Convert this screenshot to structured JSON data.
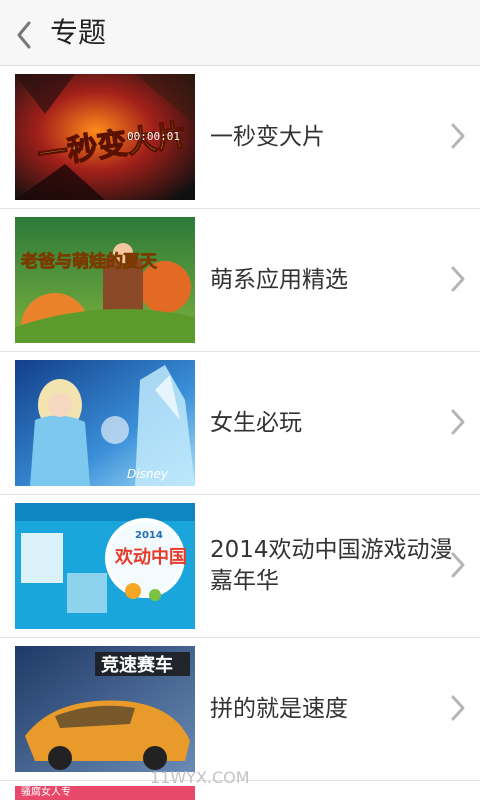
{
  "header": {
    "back_icon": "chevron-left-icon",
    "title": "专题"
  },
  "items": [
    {
      "label": "一秒变大片",
      "thumb": {
        "caption": "一秒变大片",
        "sub": "00:00:01",
        "colors": [
          "#111111",
          "#c2281f",
          "#f0a21a"
        ]
      }
    },
    {
      "label": "萌系应用精选",
      "thumb": {
        "caption": "老爸与萌娃的夏天",
        "colors": [
          "#1e7d2c",
          "#f29b2a",
          "#6fb33c"
        ]
      }
    },
    {
      "label": "女生必玩",
      "thumb": {
        "caption": "Disney",
        "colors": [
          "#1a63b8",
          "#8fd3f5",
          "#ffffff"
        ]
      }
    },
    {
      "label": "2014欢动中国游戏动漫嘉年华",
      "thumb": {
        "caption": "欢动中国",
        "sub": "2014",
        "colors": [
          "#1aa6dc",
          "#ffffff",
          "#e73c2b"
        ]
      }
    },
    {
      "label": "拼的就是速度",
      "thumb": {
        "caption": "竞速赛车",
        "colors": [
          "#2b4f86",
          "#e89b2a",
          "#d9dde3"
        ]
      }
    }
  ],
  "partial_item": {
    "caption": "骚腐女人专"
  },
  "watermark": "11WYX.COM",
  "chevron_icon": "chevron-right-icon"
}
